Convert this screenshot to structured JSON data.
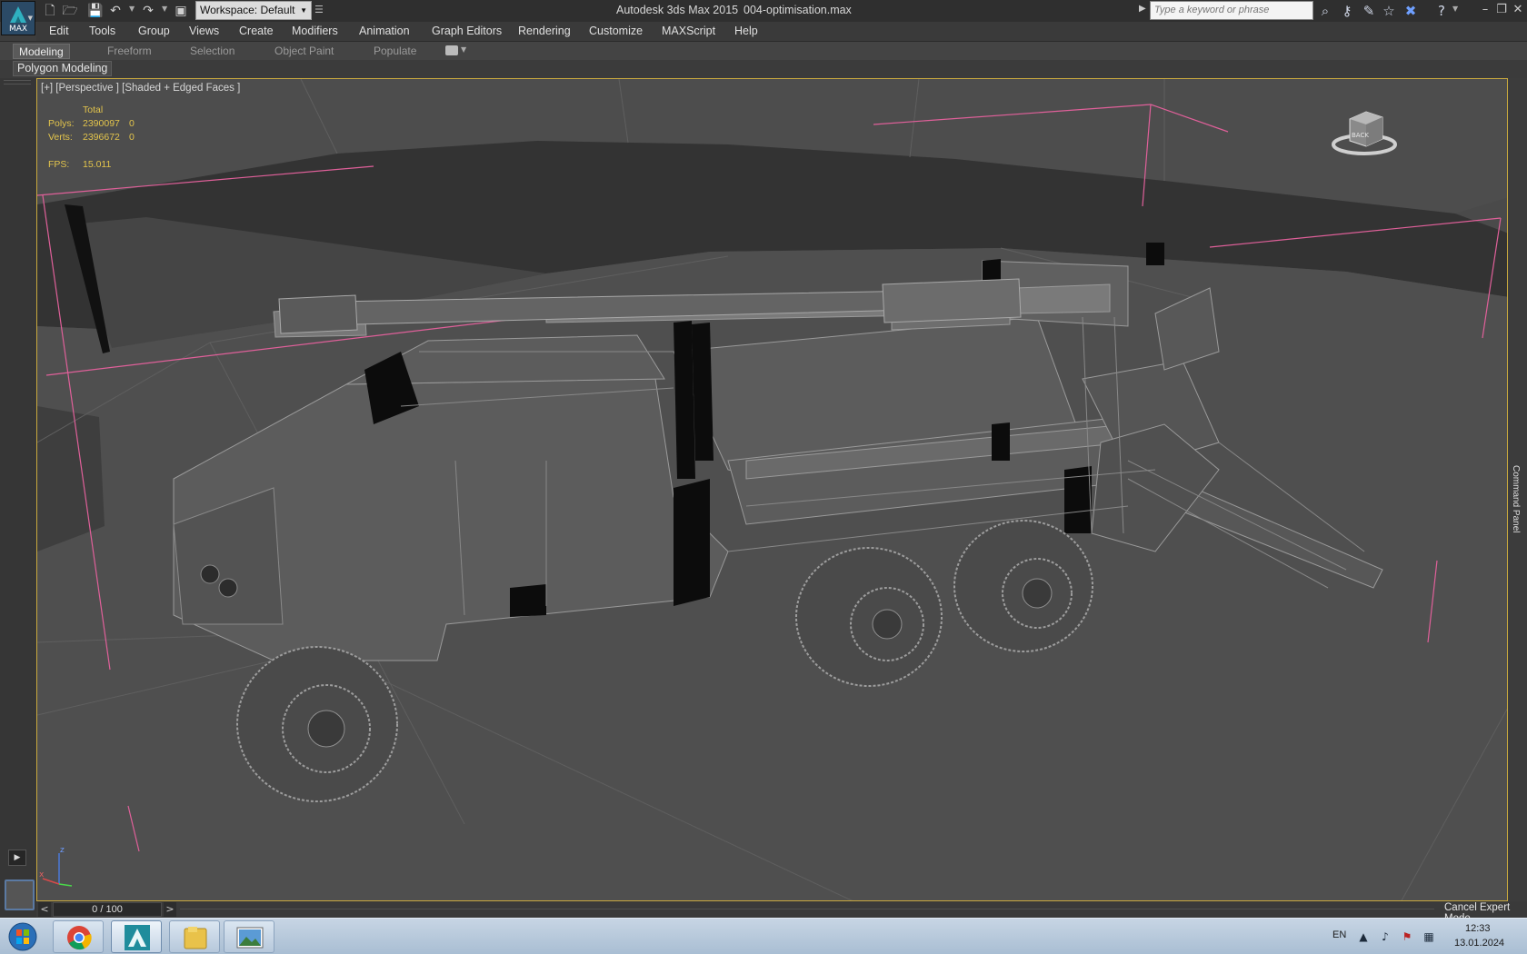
{
  "titlebar": {
    "app_name": "Autodesk 3ds Max  2015",
    "file_name": "004-optimisation.max",
    "app_button_label": "MAX",
    "workspace_label": "Workspace: Default",
    "search_placeholder": "Type a keyword or phrase"
  },
  "menu": {
    "items": [
      "Edit",
      "Tools",
      "Group",
      "Views",
      "Create",
      "Modifiers",
      "Animation",
      "Graph Editors",
      "Rendering",
      "Customize",
      "MAXScript",
      "Help"
    ]
  },
  "ribbon": {
    "tabs": [
      "Modeling",
      "Freeform",
      "Selection",
      "Object Paint",
      "Populate"
    ],
    "active_tab": "Modeling",
    "panel_label": "Polygon Modeling"
  },
  "viewport": {
    "label": "[+] [Perspective ] [Shaded + Edged Faces ]",
    "stats": {
      "total_header": "Total",
      "polys_label": "Polys:",
      "polys_value": "2390097",
      "polys_selected": "0",
      "verts_label": "Verts:",
      "verts_value": "2396672",
      "verts_selected": "0",
      "fps_label": "FPS:",
      "fps_value": "15.011"
    },
    "viewcube_label": "BACK",
    "axis_z": "z",
    "axis_x": "x",
    "border_color": "#c9a93e",
    "stats_color": "#e2c44c"
  },
  "command_panel": {
    "label": "Command Panel"
  },
  "timeline": {
    "frame_display": "0 / 100",
    "prev_symbol": "<",
    "next_symbol": ">",
    "expert_mode_button": "Cancel Expert Mode"
  },
  "taskbar": {
    "apps": [
      "start-orb",
      "chrome",
      "3ds-max",
      "explorer",
      "image-viewer"
    ],
    "language": "EN",
    "time": "12:33",
    "date": "13.01.2024"
  }
}
